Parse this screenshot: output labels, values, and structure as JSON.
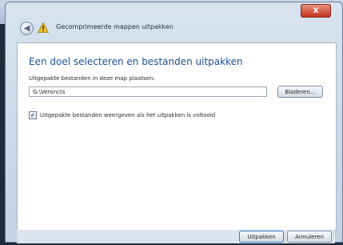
{
  "dialog": {
    "title": "Gecomprimeerde mappen uitpakken",
    "close_label": "X",
    "back_icon": "back-arrow-icon",
    "title_icon": "warning-icon"
  },
  "main": {
    "heading": "Een doel selecteren en bestanden uitpakken",
    "folder_label": "Uitgepakte bestanden in deze map plaatsen:",
    "folder_value": "G:\\Veroncts",
    "browse_label": "Bladeren...",
    "show_checkbox": {
      "label": "Uitgepakte bestanden weergeven als het uitpakken is voltooid",
      "checked": true,
      "check_mark": "✔"
    }
  },
  "footer": {
    "extract_label": "Uitpakken",
    "cancel_label": "Annuleren"
  },
  "colors": {
    "heading": "#1e4f9a",
    "close": "#c2351f",
    "window": "#d8e3ef"
  }
}
